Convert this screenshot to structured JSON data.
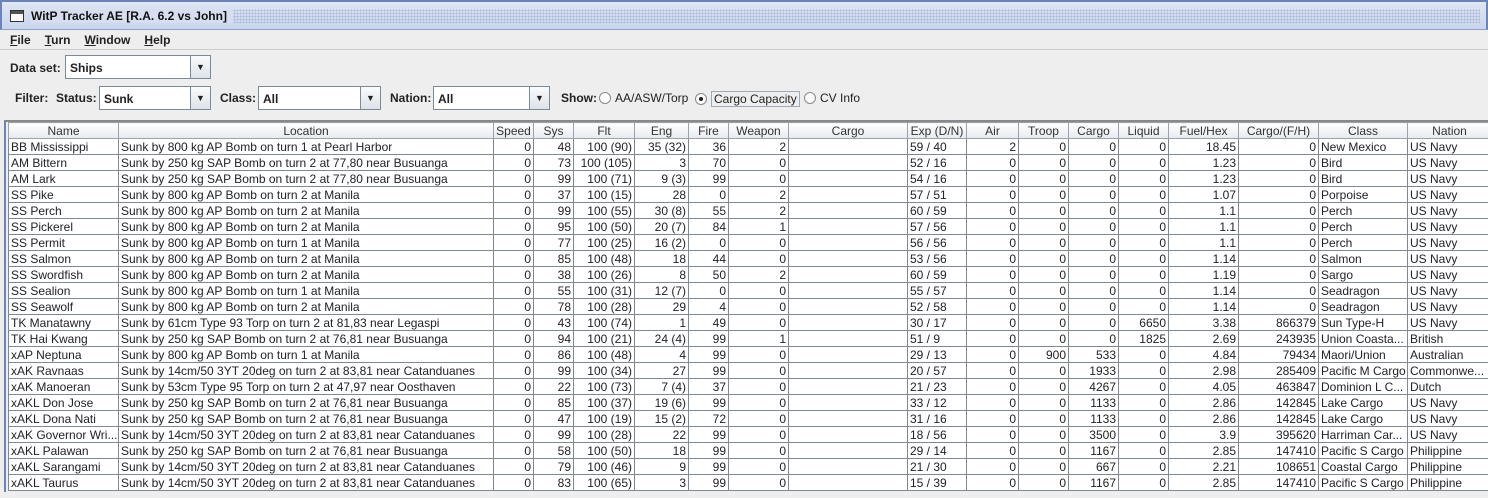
{
  "window": {
    "title": "WitP Tracker AE [R.A. 6.2 vs John]"
  },
  "menu": [
    "File",
    "Turn",
    "Window",
    "Help"
  ],
  "toolbar": {
    "dataset_label": "Data set:",
    "dataset_value": "Ships",
    "filter_label": "Filter:",
    "status_label": "Status:",
    "status_value": "Sunk",
    "class_label": "Class:",
    "class_value": "All",
    "nation_label": "Nation:",
    "nation_value": "All",
    "show_label": "Show:",
    "show_options": [
      "AA/ASW/Torp",
      "Cargo Capacity",
      "CV Info"
    ],
    "show_selected": 1
  },
  "table": {
    "columns": [
      "Name",
      "Location",
      "Speed",
      "Sys",
      "Flt",
      "Eng",
      "Fire",
      "Weapon",
      "Cargo",
      "Exp (D/N)",
      "Air",
      "Troop",
      "Cargo",
      "Liquid",
      "Fuel/Hex",
      "Cargo/(F/H)",
      "Class",
      "Nation"
    ],
    "rows": [
      [
        "BB Mississippi",
        "Sunk by 800 kg AP Bomb on turn 1 at Pearl Harbor",
        "0",
        "48",
        "100 (90)",
        "35 (32)",
        "36",
        "2",
        "",
        "59 / 40",
        "2",
        "0",
        "0",
        "0",
        "18.45",
        "0",
        "New Mexico",
        "US Navy"
      ],
      [
        "AM Bittern",
        "Sunk by 250 kg SAP Bomb on turn 2 at 77,80 near Busuanga",
        "0",
        "73",
        "100 (105)",
        "3",
        "70",
        "0",
        "",
        "52 / 16",
        "0",
        "0",
        "0",
        "0",
        "1.23",
        "0",
        "Bird",
        "US Navy"
      ],
      [
        "AM Lark",
        "Sunk by 250 kg SAP Bomb on turn 2 at 77,80 near Busuanga",
        "0",
        "99",
        "100 (71)",
        "9 (3)",
        "99",
        "0",
        "",
        "54 / 16",
        "0",
        "0",
        "0",
        "0",
        "1.23",
        "0",
        "Bird",
        "US Navy"
      ],
      [
        "SS Pike",
        "Sunk by 800 kg AP Bomb on turn 2 at Manila",
        "0",
        "37",
        "100 (15)",
        "28",
        "0",
        "2",
        "",
        "57 / 51",
        "0",
        "0",
        "0",
        "0",
        "1.07",
        "0",
        "Porpoise",
        "US Navy"
      ],
      [
        "SS Perch",
        "Sunk by 800 kg AP Bomb on turn 2 at Manila",
        "0",
        "99",
        "100 (55)",
        "30 (8)",
        "55",
        "2",
        "",
        "60 / 59",
        "0",
        "0",
        "0",
        "0",
        "1.1",
        "0",
        "Perch",
        "US Navy"
      ],
      [
        "SS Pickerel",
        "Sunk by 800 kg AP Bomb on turn 2 at Manila",
        "0",
        "95",
        "100 (50)",
        "20 (7)",
        "84",
        "1",
        "",
        "57 / 56",
        "0",
        "0",
        "0",
        "0",
        "1.1",
        "0",
        "Perch",
        "US Navy"
      ],
      [
        "SS Permit",
        "Sunk by 800 kg AP Bomb on turn 1 at Manila",
        "0",
        "77",
        "100 (25)",
        "16 (2)",
        "0",
        "0",
        "",
        "56 / 56",
        "0",
        "0",
        "0",
        "0",
        "1.1",
        "0",
        "Perch",
        "US Navy"
      ],
      [
        "SS Salmon",
        "Sunk by 800 kg AP Bomb on turn 2 at Manila",
        "0",
        "85",
        "100 (48)",
        "18",
        "44",
        "0",
        "",
        "53 / 56",
        "0",
        "0",
        "0",
        "0",
        "1.14",
        "0",
        "Salmon",
        "US Navy"
      ],
      [
        "SS Swordfish",
        "Sunk by 800 kg AP Bomb on turn 2 at Manila",
        "0",
        "38",
        "100 (26)",
        "8",
        "50",
        "2",
        "",
        "60 / 59",
        "0",
        "0",
        "0",
        "0",
        "1.19",
        "0",
        "Sargo",
        "US Navy"
      ],
      [
        "SS Sealion",
        "Sunk by 800 kg AP Bomb on turn 1 at Manila",
        "0",
        "55",
        "100 (31)",
        "12 (7)",
        "0",
        "0",
        "",
        "55 / 57",
        "0",
        "0",
        "0",
        "0",
        "1.14",
        "0",
        "Seadragon",
        "US Navy"
      ],
      [
        "SS Seawolf",
        "Sunk by 800 kg AP Bomb on turn 2 at Manila",
        "0",
        "78",
        "100 (28)",
        "29",
        "4",
        "0",
        "",
        "52 / 58",
        "0",
        "0",
        "0",
        "0",
        "1.14",
        "0",
        "Seadragon",
        "US Navy"
      ],
      [
        "TK Manatawny",
        "Sunk by 61cm Type 93 Torp on turn 2 at 81,83 near Legaspi",
        "0",
        "43",
        "100 (74)",
        "1",
        "49",
        "0",
        "",
        "30 / 17",
        "0",
        "0",
        "0",
        "6650",
        "3.38",
        "866379",
        "Sun Type-H",
        "US Navy"
      ],
      [
        "TK Hai Kwang",
        "Sunk by 250 kg SAP Bomb on turn 2 at 76,81 near Busuanga",
        "0",
        "94",
        "100 (21)",
        "24 (4)",
        "99",
        "1",
        "",
        "51 / 9",
        "0",
        "0",
        "0",
        "1825",
        "2.69",
        "243935",
        "Union Coasta...",
        "British"
      ],
      [
        "xAP Neptuna",
        "Sunk by 800 kg AP Bomb on turn 1 at Manila",
        "0",
        "86",
        "100 (48)",
        "4",
        "99",
        "0",
        "",
        "29 / 13",
        "0",
        "900",
        "533",
        "0",
        "4.84",
        "79434",
        "Maori/Union",
        "Australian"
      ],
      [
        "xAK Ravnaas",
        "Sunk by 14cm/50 3YT 20deg on turn 2 at 83,81 near Catanduanes",
        "0",
        "99",
        "100 (34)",
        "27",
        "99",
        "0",
        "",
        "20 / 57",
        "0",
        "0",
        "1933",
        "0",
        "2.98",
        "285409",
        "Pacific M Cargo",
        "Commonwe..."
      ],
      [
        "xAK Manoeran",
        "Sunk by 53cm Type 95 Torp on turn 2 at 47,97 near Oosthaven",
        "0",
        "22",
        "100 (73)",
        "7 (4)",
        "37",
        "0",
        "",
        "21 / 23",
        "0",
        "0",
        "4267",
        "0",
        "4.05",
        "463847",
        "Dominion L C...",
        "Dutch"
      ],
      [
        "xAKL Don Jose",
        "Sunk by 250 kg SAP Bomb on turn 2 at 76,81 near Busuanga",
        "0",
        "85",
        "100 (37)",
        "19 (6)",
        "99",
        "0",
        "",
        "33 / 12",
        "0",
        "0",
        "1133",
        "0",
        "2.86",
        "142845",
        "Lake Cargo",
        "US Navy"
      ],
      [
        "xAKL Dona Nati",
        "Sunk by 250 kg SAP Bomb on turn 2 at 76,81 near Busuanga",
        "0",
        "47",
        "100 (19)",
        "15 (2)",
        "72",
        "0",
        "",
        "31 / 16",
        "0",
        "0",
        "1133",
        "0",
        "2.86",
        "142845",
        "Lake Cargo",
        "US Navy"
      ],
      [
        "xAK Governor Wri...",
        "Sunk by 14cm/50 3YT 20deg on turn 2 at 83,81 near Catanduanes",
        "0",
        "99",
        "100 (28)",
        "22",
        "99",
        "0",
        "",
        "18 / 56",
        "0",
        "0",
        "3500",
        "0",
        "3.9",
        "395620",
        "Harriman Car...",
        "US Navy"
      ],
      [
        "xAKL Palawan",
        "Sunk by 250 kg SAP Bomb on turn 2 at 76,81 near Busuanga",
        "0",
        "58",
        "100 (50)",
        "18",
        "99",
        "0",
        "",
        "29 / 14",
        "0",
        "0",
        "1167",
        "0",
        "2.85",
        "147410",
        "Pacific S Cargo",
        "Philippine"
      ],
      [
        "xAKL Sarangami",
        "Sunk by 14cm/50 3YT 20deg on turn 2 at 83,81 near Catanduanes",
        "0",
        "79",
        "100 (46)",
        "9",
        "99",
        "0",
        "",
        "21 / 30",
        "0",
        "0",
        "667",
        "0",
        "2.21",
        "108651",
        "Coastal Cargo",
        "Philippine"
      ],
      [
        "xAKL Taurus",
        "Sunk by 14cm/50 3YT 20deg on turn 2 at 83,81 near Catanduanes",
        "0",
        "83",
        "100 (65)",
        "3",
        "99",
        "0",
        "",
        "15 / 39",
        "0",
        "0",
        "1167",
        "0",
        "2.85",
        "147410",
        "Pacific S Cargo",
        "Philippine"
      ]
    ]
  }
}
